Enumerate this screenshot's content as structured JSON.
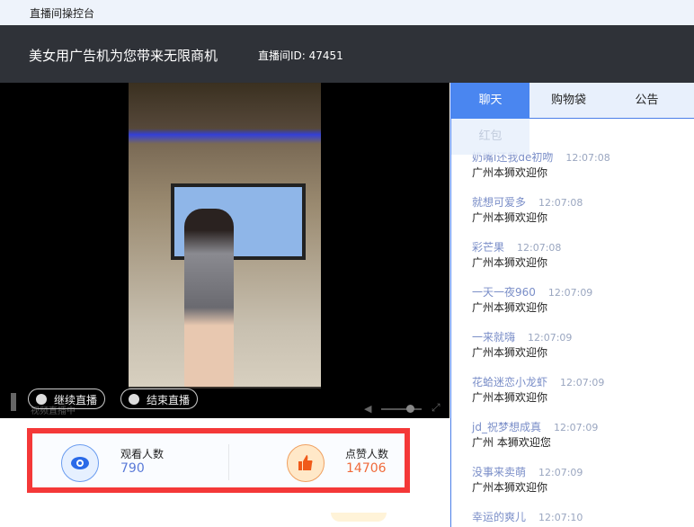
{
  "window_title": "直播间操控台",
  "header": {
    "title": "美女用广告机为您带来无限商机",
    "room_id": "直播间ID: 47451"
  },
  "video": {
    "status_text": "视频直播中",
    "continue_label": "继续直播",
    "end_label": "结束直播"
  },
  "stats": {
    "viewers_label": "观看人数",
    "viewers": "790",
    "likes_label": "点赞人数",
    "likes": "14706",
    "accent_blue": "#4a7ee8",
    "accent_orange": "#f06a2a",
    "highlight": "#f43838"
  },
  "sidebar": {
    "tabs": [
      "聊天",
      "购物袋",
      "公告"
    ],
    "red_tab": "红包"
  },
  "messages": [
    {
      "name": "奶嘴i还我de初吻",
      "time": "12:07:08",
      "text": "广州本狮欢迎你"
    },
    {
      "name": "就想可爱多",
      "time": "12:07:08",
      "text": "广州本狮欢迎你"
    },
    {
      "name": "彩芒果",
      "time": "12:07:08",
      "text": "广州本狮欢迎你"
    },
    {
      "name": "一天一夜960",
      "time": "12:07:09",
      "text": "广州本狮欢迎你"
    },
    {
      "name": "一来就嗨",
      "time": "12:07:09",
      "text": "广州本狮欢迎你"
    },
    {
      "name": "花蛤迷恋小龙虾",
      "time": "12:07:09",
      "text": "广州本狮欢迎你"
    },
    {
      "name": "jd_祝梦想成真",
      "time": "12:07:09",
      "text": "广州 本狮欢迎您"
    },
    {
      "name": "没事来卖萌",
      "time": "12:07:09",
      "text": "广州本狮欢迎你"
    },
    {
      "name": "幸运的爽儿",
      "time": "12:07:10",
      "text": ""
    }
  ]
}
